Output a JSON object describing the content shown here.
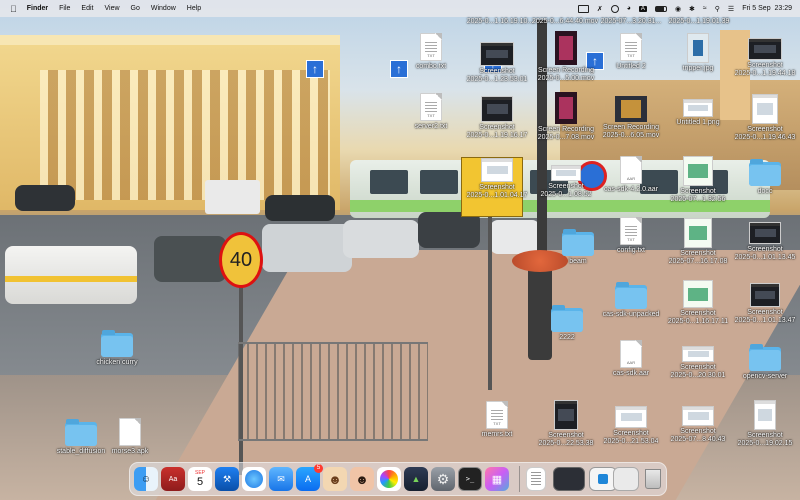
{
  "menubar": {
    "app_name": "Finder",
    "menus": [
      "File",
      "Edit",
      "View",
      "Go",
      "Window",
      "Help"
    ],
    "clock": "Fri 5 Sep  23:29",
    "input_source": "A",
    "status_icons": [
      "screen-mirroring-icon",
      "muted-icon",
      "play-icon",
      "input-source-icon",
      "battery-icon",
      "wechat-icon",
      "bluetooth-icon",
      "wifi-icon",
      "search-icon",
      "control-center-icon"
    ]
  },
  "wallpaper": {
    "speed_sign": "40"
  },
  "desktop": {
    "top_row_labels": [
      "2025-0...1.16.19.10...",
      "2025-0...6.44.40.mov",
      "2025-07...3.20.31...",
      "2025-0...1.19.01.39"
    ],
    "icons": [
      {
        "id": "combo-txt",
        "label": "combo.txt",
        "kind": "doc",
        "tag": "TXT"
      },
      {
        "id": "screenshot-1",
        "label": "Screenshot\n2025-0...1.23.53.01",
        "kind": "shot-dark"
      },
      {
        "id": "screen-recording-1",
        "label": "Screen Recording\n2025-0...5.00.mov",
        "kind": "video"
      },
      {
        "id": "untitled-2",
        "label": "Untitled 2",
        "kind": "doc",
        "tag": "TXT"
      },
      {
        "id": "tripper-jpg",
        "label": "tripper.jpg",
        "kind": "jpg"
      },
      {
        "id": "screenshot-2",
        "label": "Screenshot\n2025-0...1.19.44.18",
        "kind": "shot-dark"
      },
      {
        "id": "server2-txt",
        "label": "server2.txt",
        "kind": "doc",
        "tag": "TXT"
      },
      {
        "id": "screenshot-3",
        "label": "Screenshot\n2025-0...1.19.16.17",
        "kind": "shot-dark"
      },
      {
        "id": "screen-recording-2",
        "label": "Screen Recording\n2025-0...7.08.mov",
        "kind": "video"
      },
      {
        "id": "screen-recording-3",
        "label": "Screen Recording\n2025-0...6.05.mov",
        "kind": "video"
      },
      {
        "id": "untitled-1-png",
        "label": "Untitled 1.png",
        "kind": "shot"
      },
      {
        "id": "screenshot-4",
        "label": "Screenshot\n2025-0...1.19.46.43",
        "kind": "shot"
      },
      {
        "id": "screenshot-5",
        "label": "Screenshot\n2025-0...1.01.04.17",
        "kind": "shot"
      },
      {
        "id": "screenshot-6",
        "label": "Screenshot\n2025-0...1.08.52",
        "kind": "shot"
      },
      {
        "id": "cas-sdk-aar",
        "label": "cas-sdk-4.2.0.aar",
        "kind": "doc",
        "tag": "AAR"
      },
      {
        "id": "screenshot-7",
        "label": "Screenshot\n2025-07...1.32.56",
        "kind": "green"
      },
      {
        "id": "docc",
        "label": "docc",
        "kind": "folder"
      },
      {
        "id": "beam",
        "label": "beam",
        "kind": "folder"
      },
      {
        "id": "config-txt",
        "label": "config.txt",
        "kind": "doc",
        "tag": "TXT"
      },
      {
        "id": "screenshot-8",
        "label": "Screenshot\n2025-07...16.17.08",
        "kind": "green"
      },
      {
        "id": "screenshot-9",
        "label": "Screenshot\n2025-0...1.01.13.45",
        "kind": "shot-dark"
      },
      {
        "id": "cas-sdk-unpacked",
        "label": "cas-sdk-unpacked",
        "kind": "folder"
      },
      {
        "id": "screenshot-10",
        "label": "Screenshot\n2025-0...1.16.17.11",
        "kind": "green"
      },
      {
        "id": "screenshot-11",
        "label": "Screenshot\n2025-0...1.01.13.47",
        "kind": "shot-dark"
      },
      {
        "id": "folder-2222",
        "label": "2222",
        "kind": "folder"
      },
      {
        "id": "cas-sdk-aar-2",
        "label": "cas-sdk.aar",
        "kind": "doc",
        "tag": "AAR"
      },
      {
        "id": "screenshot-12",
        "label": "Screenshot\n2025-0...20.30.01",
        "kind": "shot"
      },
      {
        "id": "opencv-server",
        "label": "opencv-server",
        "kind": "folder"
      },
      {
        "id": "chicken-curry",
        "label": "chicken curry",
        "kind": "folder"
      },
      {
        "id": "stable-diffusion",
        "label": "stable_diffusion",
        "kind": "folder"
      },
      {
        "id": "morse3-apk",
        "label": "morse3.apk",
        "kind": "doc",
        "tag": ""
      },
      {
        "id": "memrs-txt",
        "label": "memrs.txt",
        "kind": "doc",
        "tag": "TXT"
      },
      {
        "id": "screenshot-13",
        "label": "Screenshot\n2025-0...22.53.38",
        "kind": "shot-dark"
      },
      {
        "id": "screenshot-14",
        "label": "Screenshot\n2025-0...21.53.04",
        "kind": "shot"
      },
      {
        "id": "screenshot-15",
        "label": "Screenshot\n2025-07...8.40.43",
        "kind": "shot"
      },
      {
        "id": "screenshot-16",
        "label": "Screenshot\n2025-0...19.02.15",
        "kind": "shot"
      }
    ]
  },
  "dock": {
    "calendar_month": "SEP",
    "calendar_day": "5",
    "mail_badge": "5",
    "terminal_glyph": ">_",
    "apps": [
      "finder",
      "dictionary",
      "calendar",
      "xcode",
      "safari",
      "mail",
      "app-store",
      "memoji-1",
      "memoji-2",
      "photos-like",
      "android-studio",
      "system-settings",
      "terminal",
      "launchpad"
    ],
    "recent": [
      "recent-document",
      "recent-window-1",
      "recent-window-2",
      "recent-window-3",
      "trash"
    ]
  }
}
